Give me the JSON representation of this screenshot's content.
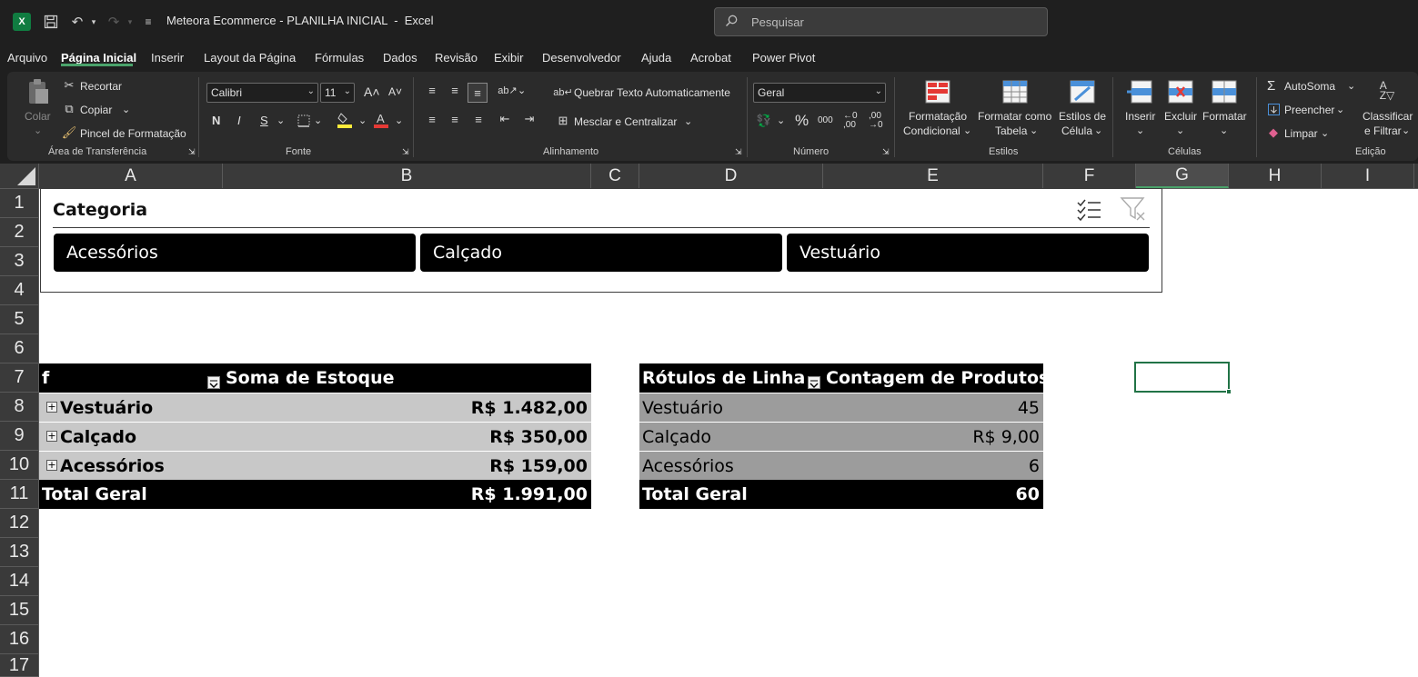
{
  "titlebar": {
    "app_icon": "excel-icon",
    "title": "Meteora Ecommerce - PLANILHA INICIAL  -  Excel",
    "search_placeholder": "Pesquisar"
  },
  "menu": {
    "items": [
      "Arquivo",
      "Página Inicial",
      "Inserir",
      "Layout da Página",
      "Fórmulas",
      "Dados",
      "Revisão",
      "Exibir",
      "Desenvolvedor",
      "Ajuda",
      "Acrobat",
      "Power Pivot"
    ],
    "active": "Página Inicial"
  },
  "ribbon": {
    "clipboard": {
      "paste": "Colar",
      "cut": "Recortar",
      "copy": "Copiar",
      "format_painter": "Pincel de Formatação",
      "group": "Área de Transferência"
    },
    "font": {
      "name": "Calibri",
      "size": "11",
      "group": "Fonte",
      "bold": "N",
      "italic": "I",
      "underline": "S"
    },
    "alignment": {
      "wrap": "Quebrar Texto Automaticamente",
      "merge": "Mesclar e Centralizar",
      "group": "Alinhamento"
    },
    "number": {
      "format": "Geral",
      "group": "Número",
      "percent": "%",
      "thousands": "000"
    },
    "styles": {
      "conditional": [
        "Formatação",
        "Condicional"
      ],
      "table": [
        "Formatar como",
        "Tabela"
      ],
      "cell": [
        "Estilos de",
        "Célula"
      ],
      "group": "Estilos"
    },
    "cells": {
      "insert": "Inserir",
      "delete": "Excluir",
      "format": "Formatar",
      "group": "Células"
    },
    "editing": {
      "autosum": "AutoSoma",
      "fill": "Preencher",
      "clear": "Limpar",
      "sort": [
        "Classificar",
        "e Filtrar"
      ],
      "group": "Edição"
    }
  },
  "sheet": {
    "columns": [
      "A",
      "B",
      "C",
      "D",
      "E",
      "F",
      "G",
      "H",
      "I"
    ],
    "selected_column": "G",
    "rows": [
      "1",
      "2",
      "3",
      "4",
      "5",
      "6",
      "7",
      "8",
      "9",
      "10",
      "11",
      "12",
      "13",
      "14",
      "15",
      "16",
      "17"
    ]
  },
  "slicer": {
    "title": "Categoria",
    "items": [
      "Acessórios",
      "Calçado",
      "Vestuário"
    ]
  },
  "pivot1": {
    "header_left": "f",
    "header_right": "Soma de Estoque",
    "rows": [
      {
        "label": "Vestuário",
        "value": "R$ 1.482,00"
      },
      {
        "label": "Calçado",
        "value": "R$ 350,00"
      },
      {
        "label": "Acessórios",
        "value": "R$ 159,00"
      }
    ],
    "total_label": "Total Geral",
    "total_value": "R$ 1.991,00"
  },
  "pivot2": {
    "header_left": "Rótulos de Linha",
    "header_right": "Contagem de Produtos",
    "rows": [
      {
        "label": "Vestuário",
        "value": "45"
      },
      {
        "label": "Calçado",
        "value": "R$ 9,00"
      },
      {
        "label": "Acessórios",
        "value": "6"
      }
    ],
    "total_label": "Total Geral",
    "total_value": "60"
  },
  "colors": {
    "accent": "#107c41",
    "selection": "#217346"
  }
}
